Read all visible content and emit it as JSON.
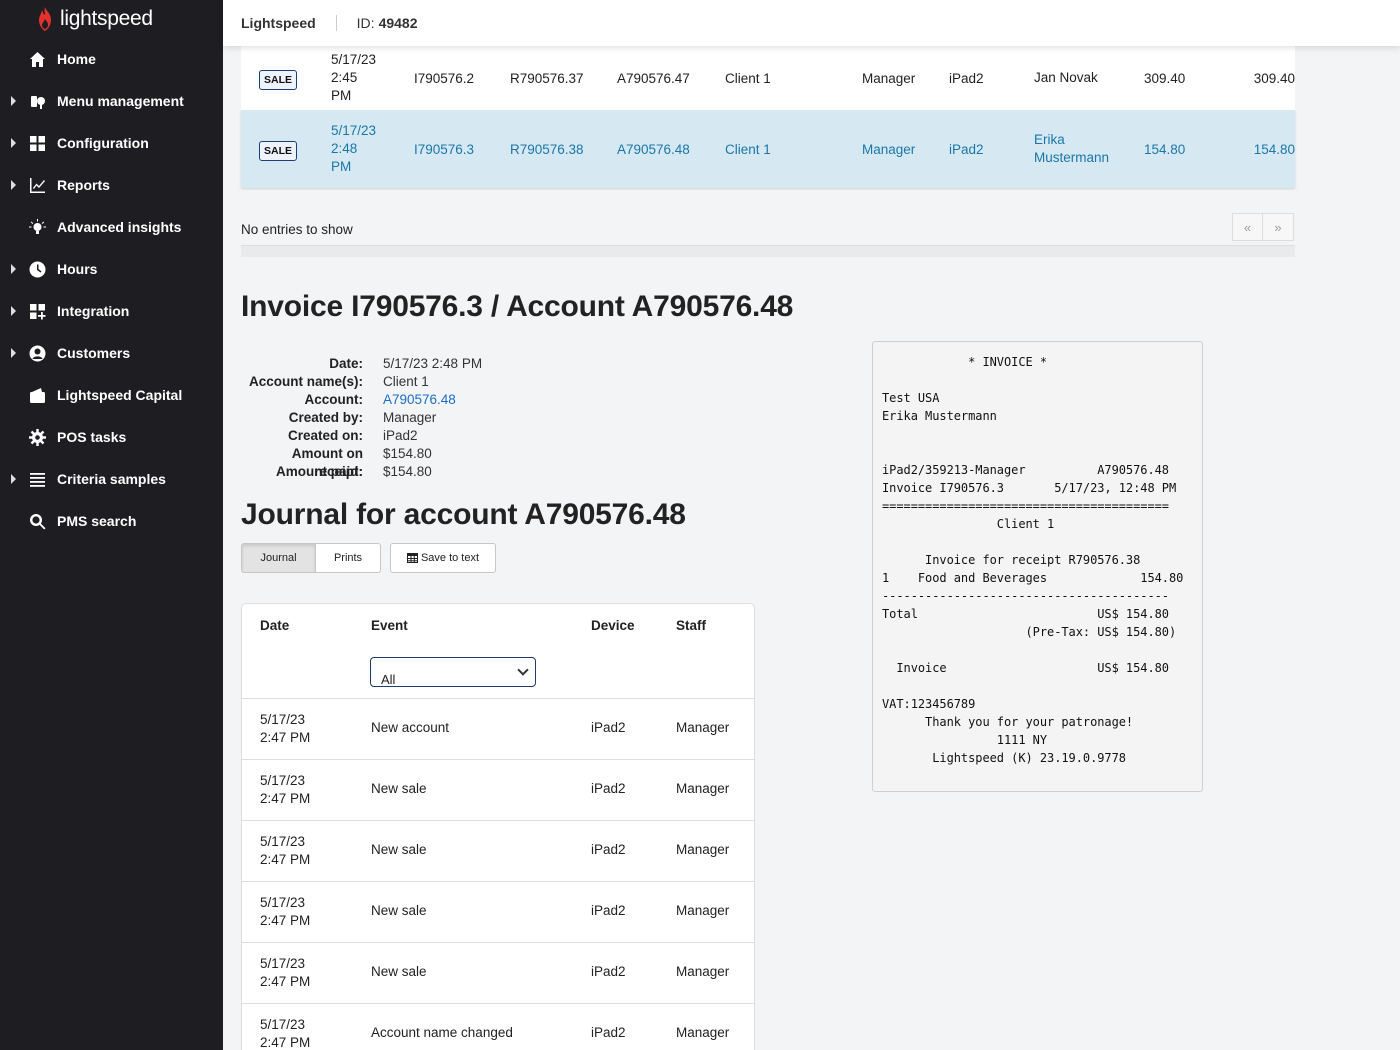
{
  "sidebar": {
    "logo_text": "lightspeed",
    "items": [
      {
        "label": "Home",
        "icon": "home-icon",
        "expandable": false
      },
      {
        "label": "Menu management",
        "icon": "menu-management-icon",
        "expandable": true
      },
      {
        "label": "Configuration",
        "icon": "grid-icon",
        "expandable": true
      },
      {
        "label": "Reports",
        "icon": "chart-icon",
        "expandable": true
      },
      {
        "label": "Advanced insights",
        "icon": "lightbulb-icon",
        "expandable": false
      },
      {
        "label": "Hours",
        "icon": "clock-icon",
        "expandable": true
      },
      {
        "label": "Integration",
        "icon": "integration-icon",
        "expandable": true
      },
      {
        "label": "Customers",
        "icon": "user-icon",
        "expandable": true
      },
      {
        "label": "Lightspeed Capital",
        "icon": "wallet-icon",
        "expandable": false
      },
      {
        "label": "POS tasks",
        "icon": "gear-icon",
        "expandable": false
      },
      {
        "label": "Criteria samples",
        "icon": "list-icon",
        "expandable": true
      },
      {
        "label": "PMS search",
        "icon": "search-icon",
        "expandable": false
      }
    ]
  },
  "header": {
    "brand": "Lightspeed",
    "id_label": "ID:",
    "id_value": "49482"
  },
  "sales": [
    {
      "badge": "SALE",
      "date": [
        "5/17/23",
        "2:45",
        "PM"
      ],
      "invoice": "I790576.2",
      "receipt": "R790576.37",
      "account": "A790576.47",
      "client": "Client 1",
      "staff": "Manager",
      "device": "iPad2",
      "employee": [
        "Jan Novak"
      ],
      "amount1": "309.40",
      "amount2": "309.40"
    },
    {
      "badge": "SALE",
      "date": [
        "5/17/23",
        "2:48",
        "PM"
      ],
      "invoice": "I790576.3",
      "receipt": "R790576.38",
      "account": "A790576.48",
      "client": "Client 1",
      "staff": "Manager",
      "device": "iPad2",
      "employee": [
        "Erika",
        "Mustermann"
      ],
      "amount1": "154.80",
      "amount2": "154.80"
    }
  ],
  "pagination": {
    "no_entries": "No entries to show",
    "prev": "«",
    "next": "»"
  },
  "invoice": {
    "title": "Invoice I790576.3 / Account A790576.48",
    "details": [
      {
        "label": "Date:",
        "value": "5/17/23 2:48 PM"
      },
      {
        "label": "Account name(s):",
        "value": "Client 1"
      },
      {
        "label": "Account:",
        "value": "A790576.48",
        "link": true
      },
      {
        "label": "Created by:",
        "value": "Manager"
      },
      {
        "label": "Created on:",
        "value": "iPad2"
      },
      {
        "label": "Amount on receipt:",
        "value": "$154.80"
      },
      {
        "label": "Amount paid:",
        "value": "$154.80"
      }
    ]
  },
  "journal": {
    "title": "Journal for account A790576.48",
    "tabs": {
      "journal": "Journal",
      "prints": "Prints"
    },
    "save_label": "Save to text",
    "columns": {
      "date": "Date",
      "event": "Event",
      "device": "Device",
      "staff": "Staff"
    },
    "filter_value": "All",
    "rows": [
      {
        "date": [
          "5/17/23",
          "2:47 PM"
        ],
        "event": "New account",
        "device": "iPad2",
        "staff": "Manager"
      },
      {
        "date": [
          "5/17/23",
          "2:47 PM"
        ],
        "event": "New sale",
        "device": "iPad2",
        "staff": "Manager"
      },
      {
        "date": [
          "5/17/23",
          "2:47 PM"
        ],
        "event": "New sale",
        "device": "iPad2",
        "staff": "Manager"
      },
      {
        "date": [
          "5/17/23",
          "2:47 PM"
        ],
        "event": "New sale",
        "device": "iPad2",
        "staff": "Manager"
      },
      {
        "date": [
          "5/17/23",
          "2:47 PM"
        ],
        "event": "New sale",
        "device": "iPad2",
        "staff": "Manager"
      },
      {
        "date": [
          "5/17/23",
          "2:47 PM"
        ],
        "event": "Account name changed",
        "device": "iPad2",
        "staff": "Manager"
      }
    ]
  },
  "receipt_text": "            * INVOICE *\n\nTest USA\nErika Mustermann\n\n\niPad2/359213-Manager          A790576.48\nInvoice I790576.3       5/17/23, 12:48 PM\n========================================\n                Client 1\n\n      Invoice for receipt R790576.38\n1    Food and Beverages             154.80\n----------------------------------------\nTotal                         US$ 154.80\n                    (Pre-Tax: US$ 154.80)\n\n  Invoice                     US$ 154.80\n\nVAT:123456789\n      Thank you for your patronage!\n                1111 NY\n       Lightspeed (K) 23.19.0.9778",
  "colors": {
    "sidebar_bg": "#1e1e22",
    "link": "#1c6dc9",
    "selected_row": "#d6e9f3",
    "brand_red": "#e4312b"
  }
}
